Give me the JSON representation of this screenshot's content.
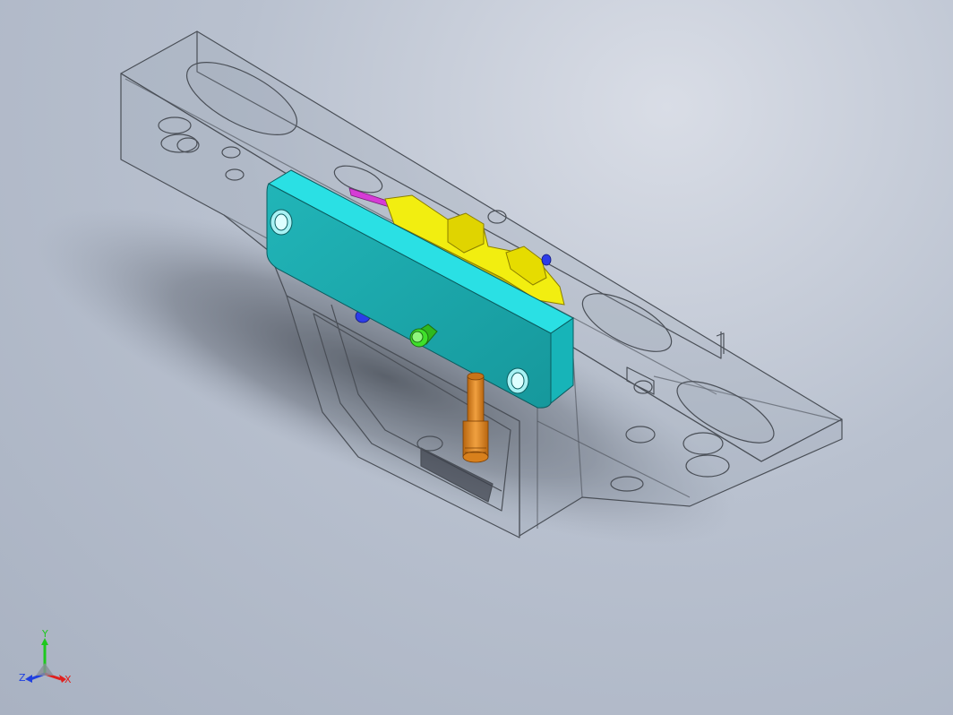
{
  "viewport": {
    "background_top": "#d9dde6",
    "background_bottom": "#a9b2c2"
  },
  "model": {
    "housing_edge_color": "#4a4f57",
    "housing_fill": "#9ba4b2",
    "side_plate_color": "#19c9cf",
    "side_plate_top_color": "#2ae0e4",
    "side_plate_hole_color": "#a8f2f4",
    "sear_color": "#f2ee10",
    "sear_shadow_color": "#c9b800",
    "trigger_shoe_color": "#e08a1e",
    "pin_color": "#2d3ce8",
    "button_color": "#3fe02a",
    "spring_color": "#d63bd6"
  },
  "triad": {
    "x_label": "X",
    "y_label": "Y",
    "z_label": "Z",
    "x_color": "#e0201e",
    "y_color": "#1ec81e",
    "z_color": "#2040e0"
  }
}
